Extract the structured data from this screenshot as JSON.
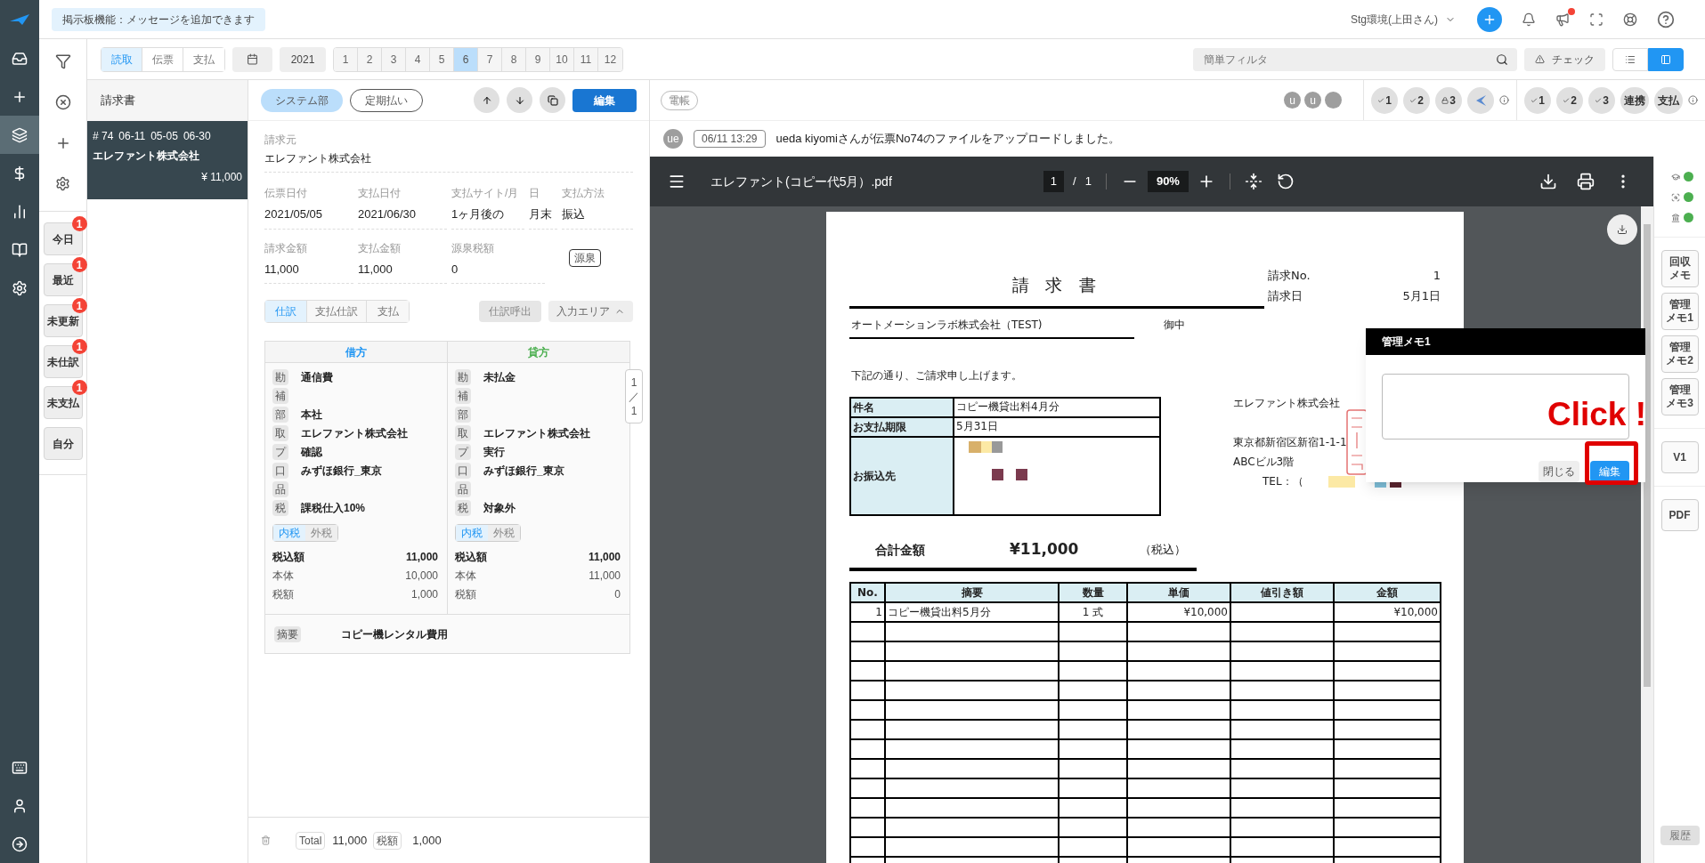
{
  "notice": "掲示板機能：メッセージを追加できます",
  "header": {
    "environment": "Stg環境(上田さん)",
    "announcement_unread": true
  },
  "toolbar": {
    "segments": [
      {
        "label": "読取",
        "selected": true
      },
      {
        "label": "伝票",
        "selected": false
      },
      {
        "label": "支払",
        "selected": false
      }
    ],
    "year": "2021",
    "months": [
      {
        "label": "1",
        "selected": false
      },
      {
        "label": "2",
        "selected": false
      },
      {
        "label": "3",
        "selected": false
      },
      {
        "label": "4",
        "selected": false
      },
      {
        "label": "5",
        "selected": false
      },
      {
        "label": "6",
        "selected": true
      },
      {
        "label": "7",
        "selected": false
      },
      {
        "label": "8",
        "selected": false
      },
      {
        "label": "9",
        "selected": false
      },
      {
        "label": "10",
        "selected": false
      },
      {
        "label": "11",
        "selected": false
      },
      {
        "label": "12",
        "selected": false
      }
    ],
    "filter_placeholder": "簡単フィルタ",
    "check": "チェック",
    "view_modes": [
      {
        "kind": "list",
        "selected": false
      },
      {
        "kind": "panel",
        "selected": true
      }
    ]
  },
  "quick_filters": [
    {
      "label": "今日",
      "badge": "1"
    },
    {
      "label": "最近",
      "badge": "1"
    },
    {
      "label": "未更新",
      "badge": "1"
    },
    {
      "label": "未仕訳",
      "badge": "1"
    },
    {
      "label": "未支払",
      "badge": "1"
    },
    {
      "label": "自分"
    }
  ],
  "list": {
    "title": "請求書",
    "items": [
      {
        "number": "# 74",
        "dates": [
          "06-11",
          "05-05",
          "06-30"
        ],
        "name": "エレファント株式会社",
        "amount": "¥ 11,000",
        "selected": true
      }
    ]
  },
  "form": {
    "tags": [
      {
        "label": "システム部",
        "kind": "filled"
      },
      {
        "label": "定期払い",
        "kind": "outline"
      }
    ],
    "edit": "編集",
    "vendor": {
      "label": "請求元",
      "value": "エレファント株式会社"
    },
    "field_rows": [
      [
        {
          "label": "伝票日付",
          "value": "2021/05/05"
        },
        {
          "label": "支払日付",
          "value": "2021/06/30"
        },
        {
          "label": "支払サイト/月",
          "value": "1ヶ月後の"
        },
        {
          "label": "日",
          "value": "月末"
        },
        {
          "label": "支払方法",
          "value": "振込"
        }
      ],
      [
        {
          "label": "請求金額",
          "value": "11,000"
        },
        {
          "label": "支払金額",
          "value": "11,000"
        },
        {
          "label": "源泉税額",
          "value": "0"
        }
      ]
    ],
    "withholding": "源泉",
    "tabs": [
      {
        "label": "仕訳",
        "selected": true
      },
      {
        "label": "支払仕訳",
        "selected": false
      },
      {
        "label": "支払",
        "selected": false
      }
    ],
    "call": {
      "label": "仕訳呼出",
      "disabled": true
    },
    "input_area": "入力エリア"
  },
  "journal": {
    "sides": [
      {
        "title": "借方",
        "color": "#2196f3",
        "rows": [
          {
            "tag": "勘",
            "value": "通信費"
          },
          {
            "tag": "補"
          },
          {
            "tag": "部",
            "value": "本社"
          },
          {
            "tag": "取",
            "value": "エレファント株式会社"
          },
          {
            "tag": "プ",
            "value": "確認"
          },
          {
            "tag": "口",
            "value": "みずほ銀行_東京"
          },
          {
            "tag": "品"
          },
          {
            "tag": "税",
            "value": "課税仕入10%"
          }
        ],
        "tax_modes": [
          {
            "label": "内税",
            "selected": true
          },
          {
            "label": "外税",
            "selected": false
          }
        ],
        "amounts": [
          {
            "label": "税込額",
            "value": "11,000",
            "kind": "total"
          },
          {
            "label": "本体",
            "value": "10,000",
            "kind": "part"
          },
          {
            "label": "税額",
            "value": "1,000",
            "kind": "part"
          }
        ]
      },
      {
        "title": "貸方",
        "color": "#4caf50",
        "rows": [
          {
            "tag": "勘",
            "value": "未払金"
          },
          {
            "tag": "補"
          },
          {
            "tag": "部"
          },
          {
            "tag": "取",
            "value": "エレファント株式会社"
          },
          {
            "tag": "プ",
            "value": "実行"
          },
          {
            "tag": "口",
            "value": "みずほ銀行_東京"
          },
          {
            "tag": "品"
          },
          {
            "tag": "税",
            "value": "対象外"
          }
        ],
        "tax_modes": [
          {
            "label": "内税",
            "selected": true
          },
          {
            "label": "外税",
            "selected": false
          }
        ],
        "amounts": [
          {
            "label": "税込額",
            "value": "11,000",
            "kind": "total"
          },
          {
            "label": "本体",
            "value": "11,000",
            "kind": "part"
          },
          {
            "label": "税額",
            "value": "0",
            "kind": "part"
          }
        ]
      }
    ],
    "pager": [
      "1",
      "／",
      "1"
    ],
    "summary": {
      "tag": "摘要",
      "value": "コピー機レンタル費用"
    }
  },
  "footer": {
    "total_label": "Total",
    "total": "11,000",
    "tax_label": "税額",
    "tax": "1,000"
  },
  "viewer_header": {
    "ledger": "電帳",
    "avatars": [
      {
        "kind": "letter",
        "initial": "u"
      },
      {
        "kind": "letter",
        "initial": "u"
      },
      {
        "kind": "blank"
      }
    ],
    "checks": [
      [
        {
          "kind": "check",
          "label": "1"
        },
        {
          "kind": "check",
          "label": "2"
        },
        {
          "kind": "lock",
          "label": "3"
        },
        {
          "kind": "logo"
        }
      ],
      [
        {
          "kind": "check",
          "label": "1"
        },
        {
          "kind": "check",
          "label": "2"
        },
        {
          "kind": "check",
          "label": "3"
        },
        {
          "kind": "text",
          "label": "連携"
        },
        {
          "kind": "text",
          "label": "支払"
        }
      ]
    ]
  },
  "activity": {
    "avatar": "ue",
    "time": "06/11 13:29",
    "message": "ueda kiyomiさんが伝票No74のファイルをアップロードしました。"
  },
  "pdf": {
    "filename": "エレファント(コピー代5月）.pdf",
    "page": "1",
    "separator": "/",
    "pages": "1",
    "zoom": "90%"
  },
  "document": {
    "title": "請 求 書",
    "meta": [
      {
        "label": "請求No.",
        "value": "1"
      },
      {
        "label": "請求日",
        "value": "5月1日"
      }
    ],
    "recipient": "オートメーションラボ株式会社（TEST)",
    "honorific": "御中",
    "intro": "下記の通り、ご請求申し上げます。",
    "info": [
      {
        "label": "件名",
        "value": "コピー機貸出料4月分"
      },
      {
        "label": "お支払期限",
        "value": "5月31日"
      },
      {
        "label": "お振込先"
      }
    ],
    "issuer": [
      "エレファント株式会社",
      "東京都新宿区新宿1-1-1",
      "ABCビル3階"
    ],
    "tel": "TEL：（",
    "total_label": "合計金額",
    "total": "¥11,000",
    "tax_note": "（税込）",
    "columns": [
      "No.",
      "摘要",
      "数量",
      "単価",
      "値引き額",
      "金額"
    ],
    "items": [
      {
        "no": "1",
        "description": "コピー機貸出料5月分",
        "quantity": "1 式",
        "unit_price": "¥10,000",
        "amount": "¥10,000"
      }
    ]
  },
  "memo": {
    "title": "管理メモ1",
    "close": "閉じる",
    "edit": "編集",
    "annotation": "Click !"
  },
  "side_status": [
    {
      "kind": "cap",
      "color": "#4caf50"
    },
    {
      "kind": "scan",
      "color": "#4caf50"
    },
    {
      "kind": "bank",
      "color": "#4caf50"
    }
  ],
  "side_buttons": [
    {
      "lines": [
        "回収",
        "メモ"
      ]
    },
    {
      "lines": [
        "管理",
        "メモ1"
      ]
    },
    {
      "lines": [
        "管理",
        "メモ2"
      ]
    },
    {
      "lines": [
        "管理",
        "メモ3"
      ]
    },
    {
      "lines": [
        "V1"
      ]
    },
    {
      "lines": [
        "PDF"
      ]
    }
  ],
  "history": "履歴"
}
